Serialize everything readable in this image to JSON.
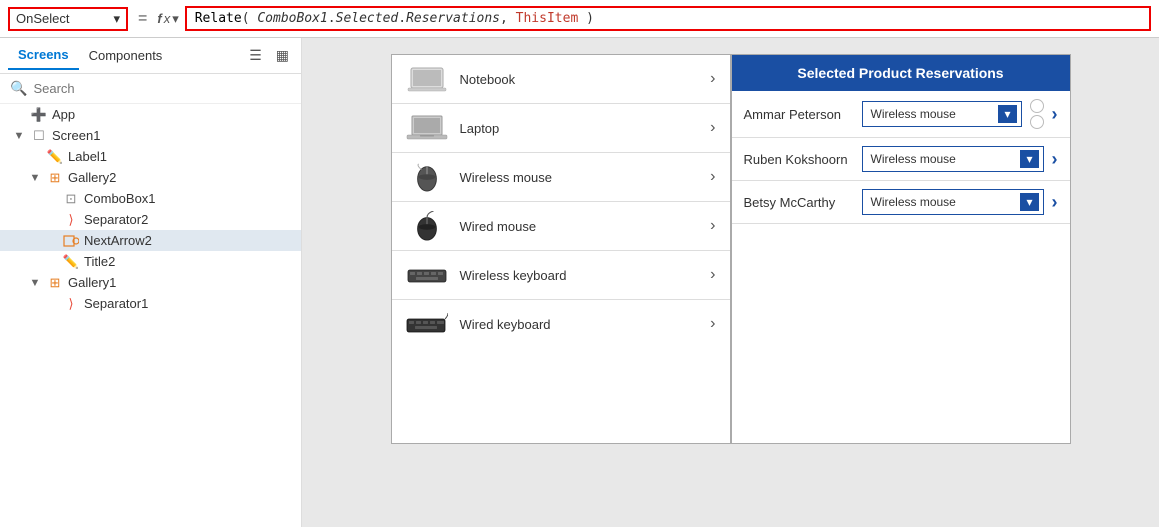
{
  "formulaBar": {
    "property": "OnSelect",
    "dropdownArrow": "▾",
    "equals": "=",
    "fxLabel": "fx",
    "fxDropArrow": "▾",
    "formula": "Relate( ComboBox1.Selected.Reservations, ThisItem )"
  },
  "leftPanel": {
    "tabs": [
      {
        "id": "screens",
        "label": "Screens",
        "active": true
      },
      {
        "id": "components",
        "label": "Components",
        "active": false
      }
    ],
    "searchPlaceholder": "Search",
    "treeItems": [
      {
        "id": "app",
        "label": "App",
        "level": 0,
        "icon": "app",
        "expandable": false
      },
      {
        "id": "screen1",
        "label": "Screen1",
        "level": 0,
        "icon": "screen",
        "expandable": true,
        "expanded": true
      },
      {
        "id": "label1",
        "label": "Label1",
        "level": 1,
        "icon": "label",
        "expandable": false
      },
      {
        "id": "gallery2",
        "label": "Gallery2",
        "level": 1,
        "icon": "gallery",
        "expandable": true,
        "expanded": true
      },
      {
        "id": "combobox1",
        "label": "ComboBox1",
        "level": 2,
        "icon": "combobox",
        "expandable": false
      },
      {
        "id": "separator2",
        "label": "Separator2",
        "level": 2,
        "icon": "separator",
        "expandable": false
      },
      {
        "id": "nextarrow2",
        "label": "NextArrow2",
        "level": 2,
        "icon": "nextarrow",
        "expandable": false,
        "selected": true
      },
      {
        "id": "title2",
        "label": "Title2",
        "level": 2,
        "icon": "title",
        "expandable": false
      },
      {
        "id": "gallery1",
        "label": "Gallery1",
        "level": 1,
        "icon": "gallery",
        "expandable": true,
        "expanded": true
      },
      {
        "id": "separator1",
        "label": "Separator1",
        "level": 2,
        "icon": "separator",
        "expandable": false
      }
    ]
  },
  "productGallery": {
    "items": [
      {
        "id": "notebook",
        "label": "Notebook",
        "imgType": "notebook"
      },
      {
        "id": "laptop",
        "label": "Laptop",
        "imgType": "laptop"
      },
      {
        "id": "wireless-mouse",
        "label": "Wireless mouse",
        "imgType": "wmouse"
      },
      {
        "id": "wired-mouse",
        "label": "Wired mouse",
        "imgType": "wiredmouse"
      },
      {
        "id": "wireless-keyboard",
        "label": "Wireless keyboard",
        "imgType": "wkeyboard"
      },
      {
        "id": "wired-keyboard",
        "label": "Wired keyboard",
        "imgType": "wiredkeyboard"
      }
    ],
    "arrowChar": "›"
  },
  "reservationsPanel": {
    "title": "Selected Product Reservations",
    "rows": [
      {
        "id": "row1",
        "name": "Ammar Peterson",
        "selectedProduct": "Wireless mouse"
      },
      {
        "id": "row2",
        "name": "Ruben Kokshoorn",
        "selectedProduct": "Wireless mouse"
      },
      {
        "id": "row3",
        "name": "Betsy McCarthy",
        "selectedProduct": "Wireless mouse"
      }
    ],
    "chevron": "›"
  },
  "colors": {
    "accent": "#1a4fa3",
    "selectedBg": "#e0e8f0",
    "headerBg": "#1a4fa3",
    "formulaBorder": "#e00000",
    "arrowBtn": "#1a4fa3"
  }
}
